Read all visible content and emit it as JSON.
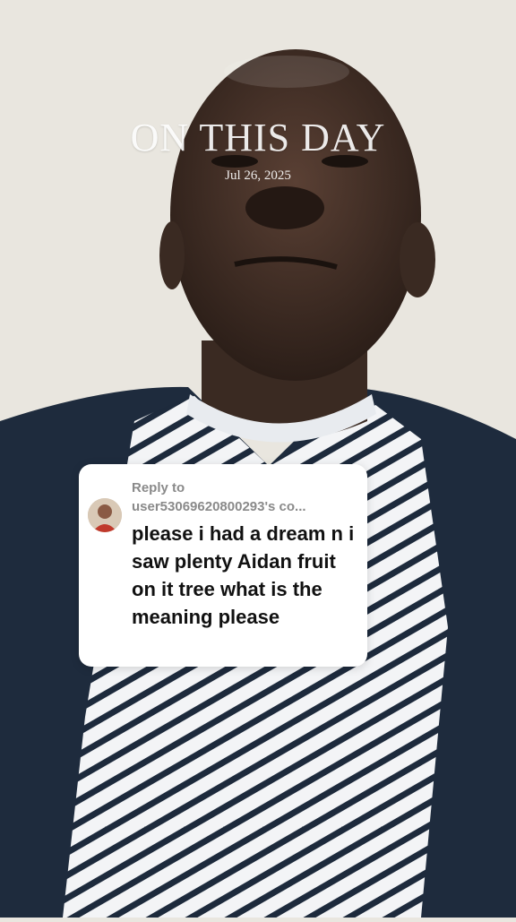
{
  "overlay": {
    "title": "ON THIS DAY",
    "date": "Jul 26, 2025"
  },
  "reply": {
    "label": "Reply to",
    "username": "user53069620800293's co...",
    "text": "please i had a dream n i saw plenty Aidan fruit on it tree what is the meaning please"
  },
  "colors": {
    "wall": "#e9e6df",
    "skin": "#3a2a22",
    "jacket": "#1e2b3d",
    "card": "#ffffff",
    "muted_text": "#8a8a8a"
  }
}
